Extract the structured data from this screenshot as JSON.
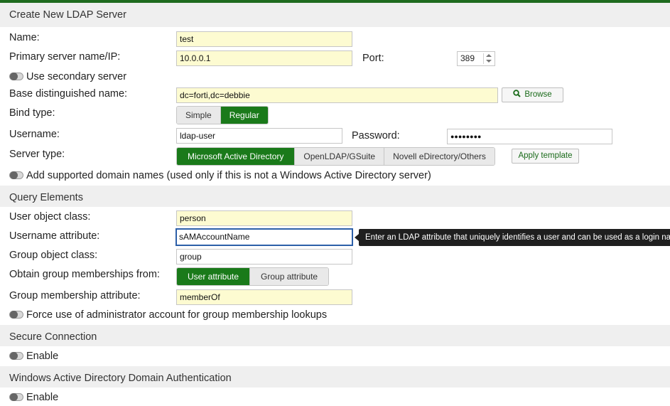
{
  "colors": {
    "accent": "#1a7a1a",
    "topbar": "#1f6b1f",
    "section_bg": "#efefef",
    "field_highlight": "#fdfbd1",
    "focus_border": "#2c5fa8"
  },
  "header": {
    "title": "Create New LDAP Server"
  },
  "form": {
    "name_label": "Name:",
    "name_value": "test",
    "primary_label": "Primary server name/IP:",
    "primary_value": "10.0.0.1",
    "port_label": "Port:",
    "port_value": "389",
    "secondary_label": "Use secondary server",
    "base_dn_label": "Base distinguished name:",
    "base_dn_value": "dc=forti,dc=debbie",
    "browse_label": "Browse",
    "bind_label": "Bind type:",
    "bind_options": [
      "Simple",
      "Regular"
    ],
    "bind_selected": "Regular",
    "username_label": "Username:",
    "username_value": "ldap-user",
    "password_label": "Password:",
    "password_value": "●●●●●●●●",
    "server_type_label": "Server type:",
    "server_types": [
      "Microsoft Active Directory",
      "OpenLDAP/GSuite",
      "Novell eDirectory/Others"
    ],
    "server_type_selected": "Microsoft Active Directory",
    "apply_template_label": "Apply template",
    "domain_names_label": "Add supported domain names (used only if this is not a Windows Active Directory server)"
  },
  "query": {
    "title": "Query Elements",
    "user_object_label": "User object class:",
    "user_object_value": "person",
    "username_attr_label": "Username attribute:",
    "username_attr_value": "sAMAccountName",
    "tooltip": "Enter an LDAP attribute that uniquely identifies a user and can be used as a login name",
    "group_object_label": "Group object class:",
    "group_object_value": "group",
    "obtain_label": "Obtain group memberships from:",
    "obtain_options": [
      "User attribute",
      "Group attribute"
    ],
    "obtain_selected": "User attribute",
    "membership_attr_label": "Group membership attribute:",
    "membership_attr_value": "memberOf",
    "force_admin_label": "Force use of administrator account for group membership lookups"
  },
  "secure": {
    "title": "Secure Connection",
    "enable_label": "Enable"
  },
  "windows": {
    "title": "Windows Active Directory Domain Authentication",
    "enable_label": "Enable"
  }
}
